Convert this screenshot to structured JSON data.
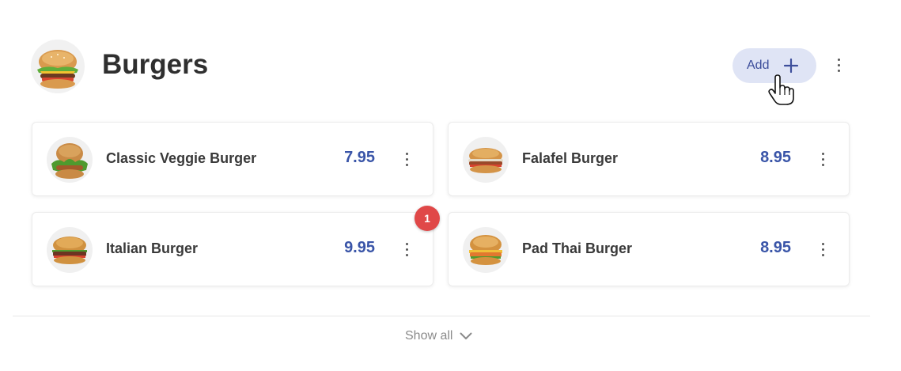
{
  "category": {
    "title": "Burgers",
    "image_icon": "burger-image"
  },
  "toolbar": {
    "add_label": "Add",
    "add_icon": "plus-icon",
    "menu_icon": "kebab-menu-icon",
    "cursor_icon": "hand-pointer-icon"
  },
  "items": [
    {
      "name": "Classic Veggie Burger",
      "price": "7.95",
      "image_icon": "burger-image"
    },
    {
      "name": "Falafel Burger",
      "price": "8.95",
      "image_icon": "burger-image"
    },
    {
      "name": "Italian Burger",
      "price": "9.95",
      "image_icon": "burger-image"
    },
    {
      "name": "Pad Thai Burger",
      "price": "8.95",
      "image_icon": "burger-image"
    }
  ],
  "badge": {
    "count": "1",
    "color": "#e04848"
  },
  "footer": {
    "show_all_label": "Show all",
    "chevron_icon": "chevron-down-icon"
  },
  "colors": {
    "accent": "#3a55a8",
    "add_button_bg": "#dfe4f5",
    "badge": "#e04848"
  }
}
